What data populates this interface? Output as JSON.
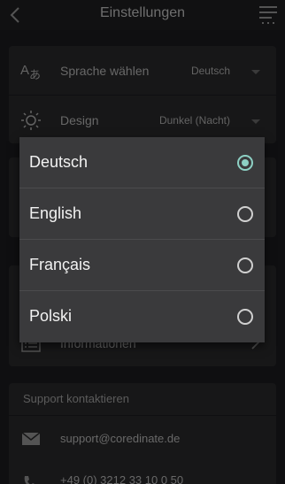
{
  "header": {
    "title": "Einstellungen",
    "back_icon": "chevron-left-icon",
    "menu_icon": "menu-icon"
  },
  "settings": {
    "language": {
      "label": "Sprache wählen",
      "value": "Deutsch",
      "icon": "translate-icon"
    },
    "design": {
      "label": "Design",
      "value": "Dunkel (Nacht)",
      "icon": "brightness-icon"
    }
  },
  "info": {
    "label": "Informationen",
    "icon": "list-icon"
  },
  "support": {
    "header": "Support kontaktieren",
    "email": "support@coredinate.de",
    "phone": "+49 (0) 3212 33 10 0 50"
  },
  "language_dialog": {
    "options": [
      {
        "label": "Deutsch",
        "selected": true
      },
      {
        "label": "English",
        "selected": false
      },
      {
        "label": "Français",
        "selected": false
      },
      {
        "label": "Polski",
        "selected": false
      }
    ]
  },
  "colors": {
    "background": "#1d1d1f",
    "card": "#2a2a2c",
    "dialog": "#3a3a3c",
    "accent": "#8dd0c4"
  }
}
